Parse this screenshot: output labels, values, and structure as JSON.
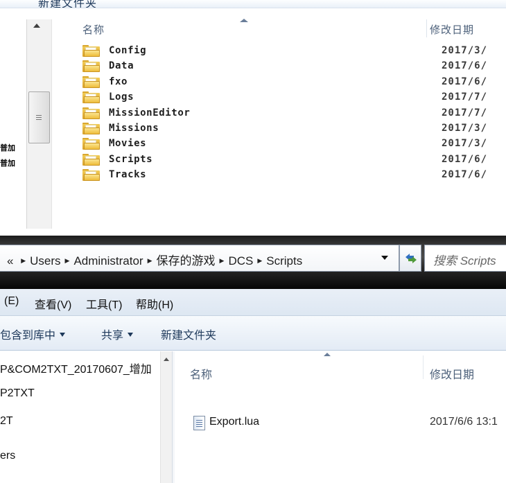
{
  "top_window": {
    "toolbar_partial_label": "新建文件夹",
    "left_labels": [
      "普加",
      "普加"
    ],
    "columns": {
      "name": "名称",
      "date": "修改日期"
    },
    "folders": [
      {
        "name": "Config",
        "date": "2017/3/"
      },
      {
        "name": "Data",
        "date": "2017/6/"
      },
      {
        "name": "fxo",
        "date": "2017/6/"
      },
      {
        "name": "Logs",
        "date": "2017/7/"
      },
      {
        "name": "MissionEditor",
        "date": "2017/7/"
      },
      {
        "name": "Missions",
        "date": "2017/3/"
      },
      {
        "name": "Movies",
        "date": "2017/3/"
      },
      {
        "name": "Scripts",
        "date": "2017/6/"
      },
      {
        "name": "Tracks",
        "date": "2017/6/"
      }
    ]
  },
  "bottom_window": {
    "address": {
      "overflow": "«",
      "crumbs": [
        "Users",
        "Administrator",
        "保存的游戏",
        "DCS",
        "Scripts"
      ]
    },
    "search_placeholder": "搜索 Scripts",
    "menu": [
      "(E)",
      "查看(V)",
      "工具(T)",
      "帮助(H)"
    ],
    "commands": {
      "include_library": "包含到库中",
      "share": "共享",
      "new_folder": "新建文件夹"
    },
    "nav_items": [
      "P&COM2TXT_20170607_增加",
      "P2TXT",
      "2T",
      "ers"
    ],
    "columns": {
      "name": "名称",
      "date": "修改日期"
    },
    "files": [
      {
        "name": "Export.lua",
        "date": "2017/6/6 13:1"
      }
    ]
  },
  "colors": {
    "header_text": "#4c607a",
    "folder": "#eebd3b",
    "address_bar_bg": "#2a2a2a",
    "command_text": "#1e395b"
  },
  "icons": [
    "folder-icon",
    "lua-file-icon",
    "refresh-icon",
    "dropdown-arrow-icon",
    "breadcrumb-arrow-icon",
    "sort-arrow-icon",
    "scroll-up-icon"
  ]
}
